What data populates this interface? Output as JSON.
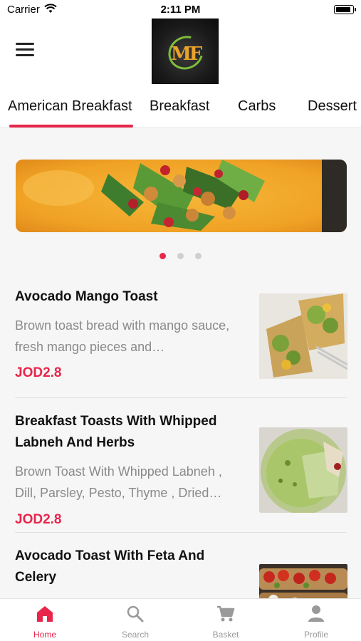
{
  "status_bar": {
    "carrier": "Carrier",
    "time": "2:11 PM"
  },
  "header": {
    "logo_text": "MF"
  },
  "tabs": [
    {
      "label": "American Breakfast",
      "active": true
    },
    {
      "label": "Breakfast",
      "active": false
    },
    {
      "label": "Carbs",
      "active": false
    },
    {
      "label": "Dessert",
      "active": false
    }
  ],
  "carousel": {
    "slide_count": 3,
    "active_index": 0
  },
  "products": [
    {
      "name": "Avocado Mango Toast",
      "description": "Brown toast bread with mango sauce, fresh mango pieces and…",
      "price": "JOD2.8"
    },
    {
      "name": "Breakfast Toasts With Whipped Labneh And Herbs",
      "description": "Brown Toast With Whipped Labneh , Dill, Parsley, Pesto, Thyme , Dried…",
      "price": "JOD2.8"
    },
    {
      "name": "Avocado Toast With Feta And Celery",
      "description": "",
      "price": ""
    }
  ],
  "bottom_nav": [
    {
      "label": "Home",
      "icon": "home-icon",
      "active": true
    },
    {
      "label": "Search",
      "icon": "search-icon",
      "active": false
    },
    {
      "label": "Basket",
      "icon": "cart-icon",
      "active": false
    },
    {
      "label": "Profile",
      "icon": "profile-icon",
      "active": false
    }
  ],
  "colors": {
    "accent": "#e8264b",
    "muted_text": "#8a8a8a",
    "background": "#f6f6f6"
  }
}
